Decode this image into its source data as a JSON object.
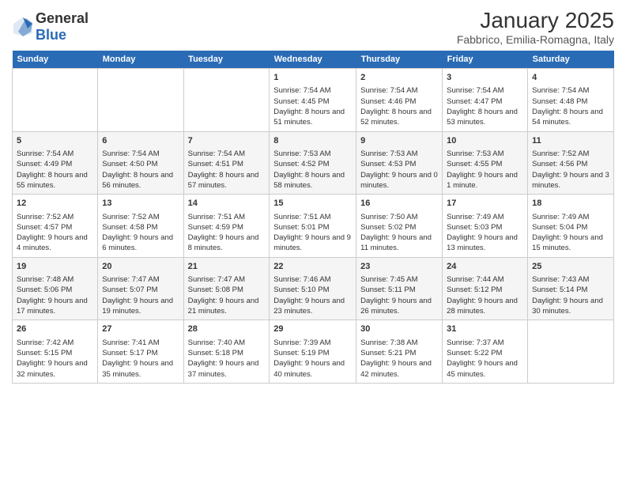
{
  "header": {
    "logo_general": "General",
    "logo_blue": "Blue",
    "month": "January 2025",
    "location": "Fabbrico, Emilia-Romagna, Italy"
  },
  "weekdays": [
    "Sunday",
    "Monday",
    "Tuesday",
    "Wednesday",
    "Thursday",
    "Friday",
    "Saturday"
  ],
  "weeks": [
    [
      {
        "day": "",
        "sunrise": "",
        "sunset": "",
        "daylight": ""
      },
      {
        "day": "",
        "sunrise": "",
        "sunset": "",
        "daylight": ""
      },
      {
        "day": "",
        "sunrise": "",
        "sunset": "",
        "daylight": ""
      },
      {
        "day": "1",
        "sunrise": "Sunrise: 7:54 AM",
        "sunset": "Sunset: 4:45 PM",
        "daylight": "Daylight: 8 hours and 51 minutes."
      },
      {
        "day": "2",
        "sunrise": "Sunrise: 7:54 AM",
        "sunset": "Sunset: 4:46 PM",
        "daylight": "Daylight: 8 hours and 52 minutes."
      },
      {
        "day": "3",
        "sunrise": "Sunrise: 7:54 AM",
        "sunset": "Sunset: 4:47 PM",
        "daylight": "Daylight: 8 hours and 53 minutes."
      },
      {
        "day": "4",
        "sunrise": "Sunrise: 7:54 AM",
        "sunset": "Sunset: 4:48 PM",
        "daylight": "Daylight: 8 hours and 54 minutes."
      }
    ],
    [
      {
        "day": "5",
        "sunrise": "Sunrise: 7:54 AM",
        "sunset": "Sunset: 4:49 PM",
        "daylight": "Daylight: 8 hours and 55 minutes."
      },
      {
        "day": "6",
        "sunrise": "Sunrise: 7:54 AM",
        "sunset": "Sunset: 4:50 PM",
        "daylight": "Daylight: 8 hours and 56 minutes."
      },
      {
        "day": "7",
        "sunrise": "Sunrise: 7:54 AM",
        "sunset": "Sunset: 4:51 PM",
        "daylight": "Daylight: 8 hours and 57 minutes."
      },
      {
        "day": "8",
        "sunrise": "Sunrise: 7:53 AM",
        "sunset": "Sunset: 4:52 PM",
        "daylight": "Daylight: 8 hours and 58 minutes."
      },
      {
        "day": "9",
        "sunrise": "Sunrise: 7:53 AM",
        "sunset": "Sunset: 4:53 PM",
        "daylight": "Daylight: 9 hours and 0 minutes."
      },
      {
        "day": "10",
        "sunrise": "Sunrise: 7:53 AM",
        "sunset": "Sunset: 4:55 PM",
        "daylight": "Daylight: 9 hours and 1 minute."
      },
      {
        "day": "11",
        "sunrise": "Sunrise: 7:52 AM",
        "sunset": "Sunset: 4:56 PM",
        "daylight": "Daylight: 9 hours and 3 minutes."
      }
    ],
    [
      {
        "day": "12",
        "sunrise": "Sunrise: 7:52 AM",
        "sunset": "Sunset: 4:57 PM",
        "daylight": "Daylight: 9 hours and 4 minutes."
      },
      {
        "day": "13",
        "sunrise": "Sunrise: 7:52 AM",
        "sunset": "Sunset: 4:58 PM",
        "daylight": "Daylight: 9 hours and 6 minutes."
      },
      {
        "day": "14",
        "sunrise": "Sunrise: 7:51 AM",
        "sunset": "Sunset: 4:59 PM",
        "daylight": "Daylight: 9 hours and 8 minutes."
      },
      {
        "day": "15",
        "sunrise": "Sunrise: 7:51 AM",
        "sunset": "Sunset: 5:01 PM",
        "daylight": "Daylight: 9 hours and 9 minutes."
      },
      {
        "day": "16",
        "sunrise": "Sunrise: 7:50 AM",
        "sunset": "Sunset: 5:02 PM",
        "daylight": "Daylight: 9 hours and 11 minutes."
      },
      {
        "day": "17",
        "sunrise": "Sunrise: 7:49 AM",
        "sunset": "Sunset: 5:03 PM",
        "daylight": "Daylight: 9 hours and 13 minutes."
      },
      {
        "day": "18",
        "sunrise": "Sunrise: 7:49 AM",
        "sunset": "Sunset: 5:04 PM",
        "daylight": "Daylight: 9 hours and 15 minutes."
      }
    ],
    [
      {
        "day": "19",
        "sunrise": "Sunrise: 7:48 AM",
        "sunset": "Sunset: 5:06 PM",
        "daylight": "Daylight: 9 hours and 17 minutes."
      },
      {
        "day": "20",
        "sunrise": "Sunrise: 7:47 AM",
        "sunset": "Sunset: 5:07 PM",
        "daylight": "Daylight: 9 hours and 19 minutes."
      },
      {
        "day": "21",
        "sunrise": "Sunrise: 7:47 AM",
        "sunset": "Sunset: 5:08 PM",
        "daylight": "Daylight: 9 hours and 21 minutes."
      },
      {
        "day": "22",
        "sunrise": "Sunrise: 7:46 AM",
        "sunset": "Sunset: 5:10 PM",
        "daylight": "Daylight: 9 hours and 23 minutes."
      },
      {
        "day": "23",
        "sunrise": "Sunrise: 7:45 AM",
        "sunset": "Sunset: 5:11 PM",
        "daylight": "Daylight: 9 hours and 26 minutes."
      },
      {
        "day": "24",
        "sunrise": "Sunrise: 7:44 AM",
        "sunset": "Sunset: 5:12 PM",
        "daylight": "Daylight: 9 hours and 28 minutes."
      },
      {
        "day": "25",
        "sunrise": "Sunrise: 7:43 AM",
        "sunset": "Sunset: 5:14 PM",
        "daylight": "Daylight: 9 hours and 30 minutes."
      }
    ],
    [
      {
        "day": "26",
        "sunrise": "Sunrise: 7:42 AM",
        "sunset": "Sunset: 5:15 PM",
        "daylight": "Daylight: 9 hours and 32 minutes."
      },
      {
        "day": "27",
        "sunrise": "Sunrise: 7:41 AM",
        "sunset": "Sunset: 5:17 PM",
        "daylight": "Daylight: 9 hours and 35 minutes."
      },
      {
        "day": "28",
        "sunrise": "Sunrise: 7:40 AM",
        "sunset": "Sunset: 5:18 PM",
        "daylight": "Daylight: 9 hours and 37 minutes."
      },
      {
        "day": "29",
        "sunrise": "Sunrise: 7:39 AM",
        "sunset": "Sunset: 5:19 PM",
        "daylight": "Daylight: 9 hours and 40 minutes."
      },
      {
        "day": "30",
        "sunrise": "Sunrise: 7:38 AM",
        "sunset": "Sunset: 5:21 PM",
        "daylight": "Daylight: 9 hours and 42 minutes."
      },
      {
        "day": "31",
        "sunrise": "Sunrise: 7:37 AM",
        "sunset": "Sunset: 5:22 PM",
        "daylight": "Daylight: 9 hours and 45 minutes."
      },
      {
        "day": "",
        "sunrise": "",
        "sunset": "",
        "daylight": ""
      }
    ]
  ]
}
